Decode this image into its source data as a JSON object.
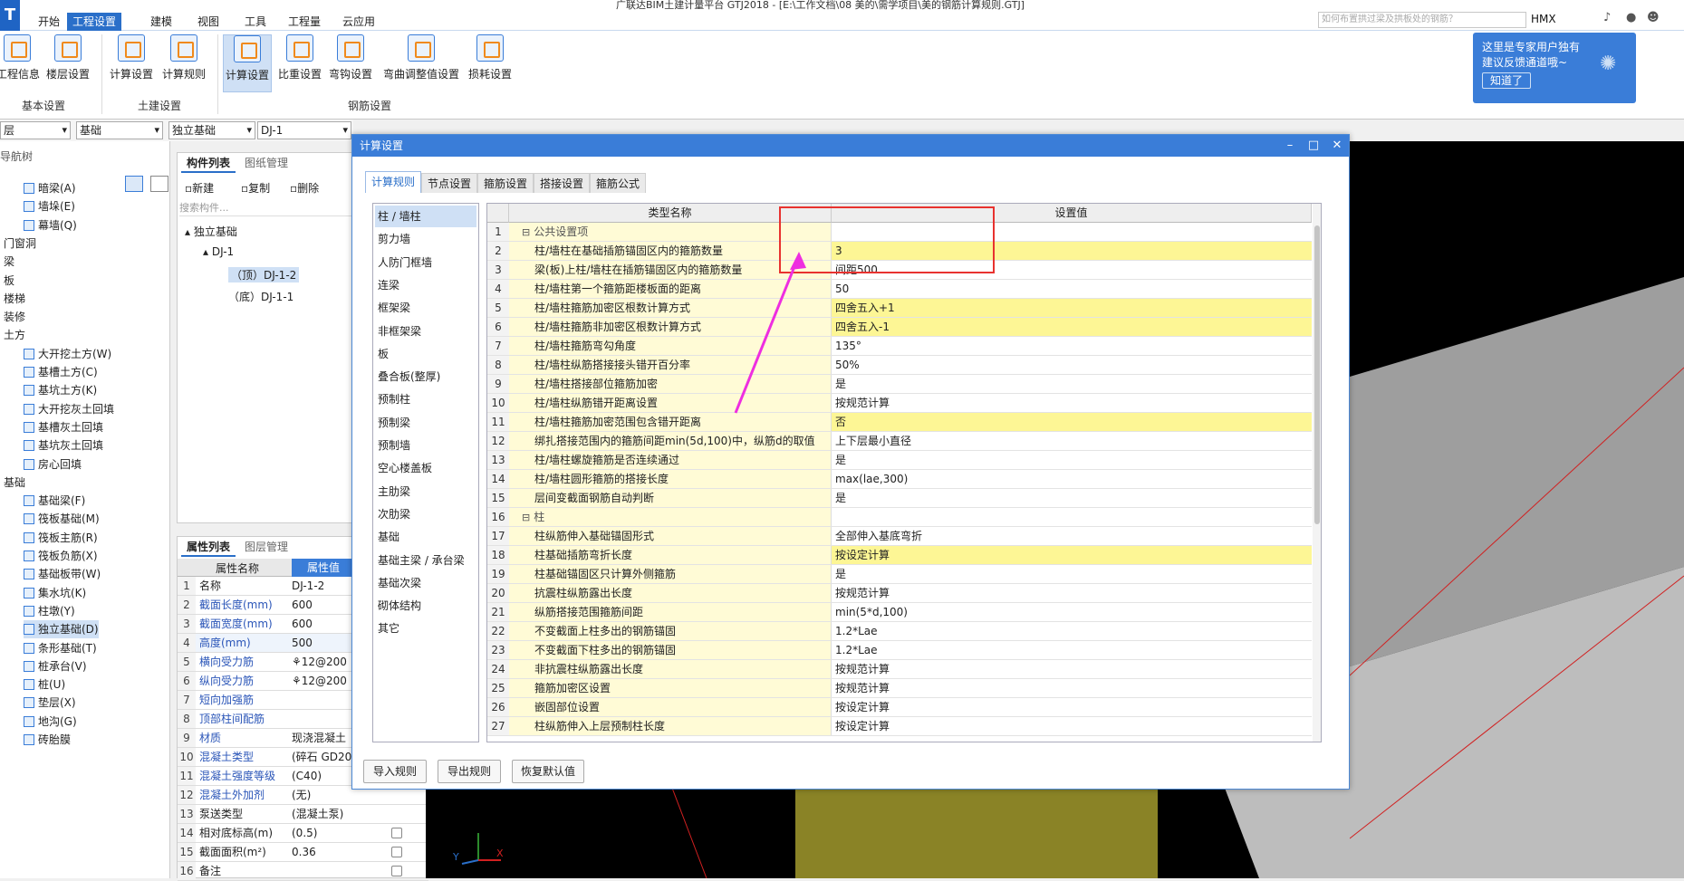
{
  "window": {
    "title": "广联达BIM土建计量平台 GTJ2018 - [E:\\工作文档\\08 美的\\需学项目\\美的钢筋计算规则.GTJ]",
    "search_placeholder": "如何布置拱过梁及拱板处的钢筋？",
    "user": "HMX"
  },
  "ribbon_tabs": [
    "开始",
    "工程设置",
    "建模",
    "视图",
    "工具",
    "工程量",
    "云应用"
  ],
  "ribbon_buttons": [
    "工程信息",
    "楼层设置",
    "计算设置",
    "计算规则",
    "计算设置",
    "比重设置",
    "弯钩设置",
    "弯曲调整值设置",
    "损耗设置"
  ],
  "ribbon_groups": [
    "基本设置",
    "土建设置",
    "钢筋设置"
  ],
  "combos": [
    "层",
    "基础",
    "独立基础",
    "DJ-1"
  ],
  "nav": {
    "title": "导航树",
    "items": [
      {
        "label": "暗梁(A)",
        "type": "item"
      },
      {
        "label": "墙垛(E)",
        "type": "item"
      },
      {
        "label": "幕墙(Q)",
        "type": "item"
      },
      {
        "label": "门窗洞",
        "type": "cat"
      },
      {
        "label": "梁",
        "type": "cat"
      },
      {
        "label": "板",
        "type": "cat"
      },
      {
        "label": "楼梯",
        "type": "cat"
      },
      {
        "label": "装修",
        "type": "cat"
      },
      {
        "label": "土方",
        "type": "cat"
      },
      {
        "label": "大开挖土方(W)",
        "type": "item"
      },
      {
        "label": "基槽土方(C)",
        "type": "item"
      },
      {
        "label": "基坑土方(K)",
        "type": "item"
      },
      {
        "label": "大开挖灰土回填",
        "type": "item"
      },
      {
        "label": "基槽灰土回填",
        "type": "item"
      },
      {
        "label": "基坑灰土回填",
        "type": "item"
      },
      {
        "label": "房心回填",
        "type": "item"
      },
      {
        "label": "基础",
        "type": "cat"
      },
      {
        "label": "基础梁(F)",
        "type": "item"
      },
      {
        "label": "筏板基础(M)",
        "type": "item"
      },
      {
        "label": "筏板主筋(R)",
        "type": "item"
      },
      {
        "label": "筏板负筋(X)",
        "type": "item"
      },
      {
        "label": "基础板带(W)",
        "type": "item"
      },
      {
        "label": "集水坑(K)",
        "type": "item"
      },
      {
        "label": "柱墩(Y)",
        "type": "item"
      },
      {
        "label": "独立基础(D)",
        "type": "sel"
      },
      {
        "label": "条形基础(T)",
        "type": "item"
      },
      {
        "label": "桩承台(V)",
        "type": "item"
      },
      {
        "label": "桩(U)",
        "type": "item"
      },
      {
        "label": "垫层(X)",
        "type": "item"
      },
      {
        "label": "地沟(G)",
        "type": "item"
      },
      {
        "label": "砖胎膜",
        "type": "item"
      }
    ]
  },
  "complist": {
    "tabs": [
      "构件列表",
      "图纸管理"
    ],
    "toolbar": [
      "新建",
      "复制",
      "删除"
    ],
    "search_placeholder": "搜索构件...",
    "tree": [
      "独立基础",
      "DJ-1",
      "（顶）DJ-1-2",
      "（底）DJ-1-1"
    ]
  },
  "props": {
    "tabs": [
      "属性列表",
      "图层管理"
    ],
    "headers": [
      "属性名称",
      "属性值"
    ],
    "rows": [
      {
        "n": "1",
        "k": "名称",
        "v": "DJ-1-2",
        "c": false
      },
      {
        "n": "2",
        "k": "截面长度(mm)",
        "v": "600",
        "c": false
      },
      {
        "n": "3",
        "k": "截面宽度(mm)",
        "v": "600",
        "c": false
      },
      {
        "n": "4",
        "k": "高度(mm)",
        "v": "500",
        "c": false
      },
      {
        "n": "5",
        "k": "横向受力筋",
        "v": "⚘12@200",
        "c": false
      },
      {
        "n": "6",
        "k": "纵向受力筋",
        "v": "⚘12@200",
        "c": false
      },
      {
        "n": "7",
        "k": "短向加强筋",
        "v": "",
        "c": false
      },
      {
        "n": "8",
        "k": "顶部柱间配筋",
        "v": "",
        "c": false
      },
      {
        "n": "9",
        "k": "材质",
        "v": "现浇混凝土",
        "c": false
      },
      {
        "n": "10",
        "k": "混凝土类型",
        "v": "(碎石 GD20",
        "c": false
      },
      {
        "n": "11",
        "k": "混凝土强度等级",
        "v": "(C40)",
        "c": false
      },
      {
        "n": "12",
        "k": "混凝土外加剂",
        "v": "(无)",
        "c": false
      },
      {
        "n": "13",
        "k": "泵送类型",
        "v": "(混凝土泵)",
        "c": false
      },
      {
        "n": "14",
        "k": "相对底标高(m)",
        "v": "(0.5)",
        "c": true
      },
      {
        "n": "15",
        "k": "截面面积(m²)",
        "v": "0.36",
        "c": true
      },
      {
        "n": "16",
        "k": "备注",
        "v": "",
        "c": true
      }
    ]
  },
  "dialog": {
    "title": "计算设置",
    "tabs": [
      "计算规则",
      "节点设置",
      "箍筋设置",
      "搭接设置",
      "箍筋公式"
    ],
    "categories": [
      "柱 / 墙柱",
      "剪力墙",
      "人防门框墙",
      "连梁",
      "框架梁",
      "非框架梁",
      "板",
      "叠合板(整厚)",
      "预制柱",
      "预制梁",
      "预制墙",
      "空心楼盖板",
      "主肋梁",
      "次肋梁",
      "基础",
      "基础主梁 / 承台梁",
      "基础次梁",
      "砌体结构",
      "其它"
    ],
    "headers": [
      "类型名称",
      "设置值"
    ],
    "rows": [
      {
        "n": "1",
        "k": "公共设置项",
        "v": "",
        "g": true,
        "h": false
      },
      {
        "n": "2",
        "k": "柱/墙柱在基础插筋锚固区内的箍筋数量",
        "v": "3",
        "g": false,
        "h": true
      },
      {
        "n": "3",
        "k": "梁(板)上柱/墙柱在插筋锚固区内的箍筋数量",
        "v": "间距500",
        "g": false,
        "h": false
      },
      {
        "n": "4",
        "k": "柱/墙柱第一个箍筋距楼板面的距离",
        "v": "50",
        "g": false,
        "h": false
      },
      {
        "n": "5",
        "k": "柱/墙柱箍筋加密区根数计算方式",
        "v": "四舍五入+1",
        "g": false,
        "h": true
      },
      {
        "n": "6",
        "k": "柱/墙柱箍筋非加密区根数计算方式",
        "v": "四舍五入-1",
        "g": false,
        "h": true
      },
      {
        "n": "7",
        "k": "柱/墙柱箍筋弯勾角度",
        "v": "135°",
        "g": false,
        "h": false
      },
      {
        "n": "8",
        "k": "柱/墙柱纵筋搭接接头错开百分率",
        "v": "50%",
        "g": false,
        "h": false
      },
      {
        "n": "9",
        "k": "柱/墙柱搭接部位箍筋加密",
        "v": "是",
        "g": false,
        "h": false
      },
      {
        "n": "10",
        "k": "柱/墙柱纵筋错开距离设置",
        "v": "按规范计算",
        "g": false,
        "h": false
      },
      {
        "n": "11",
        "k": "柱/墙柱箍筋加密范围包含错开距离",
        "v": "否",
        "g": false,
        "h": true
      },
      {
        "n": "12",
        "k": "绑扎搭接范围内的箍筋间距min(5d,100)中，纵筋d的取值",
        "v": "上下层最小直径",
        "g": false,
        "h": false
      },
      {
        "n": "13",
        "k": "柱/墙柱螺旋箍筋是否连续通过",
        "v": "是",
        "g": false,
        "h": false
      },
      {
        "n": "14",
        "k": "柱/墙柱圆形箍筋的搭接长度",
        "v": "max(lae,300)",
        "g": false,
        "h": false
      },
      {
        "n": "15",
        "k": "层间变截面钢筋自动判断",
        "v": "是",
        "g": false,
        "h": false
      },
      {
        "n": "16",
        "k": "柱",
        "v": "",
        "g": true,
        "h": false
      },
      {
        "n": "17",
        "k": "柱纵筋伸入基础锚固形式",
        "v": "全部伸入基底弯折",
        "g": false,
        "h": false
      },
      {
        "n": "18",
        "k": "柱基础插筋弯折长度",
        "v": "按设定计算",
        "g": false,
        "h": true
      },
      {
        "n": "19",
        "k": "柱基础锚固区只计算外侧箍筋",
        "v": "是",
        "g": false,
        "h": false
      },
      {
        "n": "20",
        "k": "抗震柱纵筋露出长度",
        "v": "按规范计算",
        "g": false,
        "h": false
      },
      {
        "n": "21",
        "k": "纵筋搭接范围箍筋间距",
        "v": "min(5*d,100)",
        "g": false,
        "h": false
      },
      {
        "n": "22",
        "k": "不变截面上柱多出的钢筋锚固",
        "v": "1.2*Lae",
        "g": false,
        "h": false
      },
      {
        "n": "23",
        "k": "不变截面下柱多出的钢筋锚固",
        "v": "1.2*Lae",
        "g": false,
        "h": false
      },
      {
        "n": "24",
        "k": "非抗震柱纵筋露出长度",
        "v": "按规范计算",
        "g": false,
        "h": false
      },
      {
        "n": "25",
        "k": "箍筋加密区设置",
        "v": "按规范计算",
        "g": false,
        "h": false
      },
      {
        "n": "26",
        "k": "嵌固部位设置",
        "v": "按设定计算",
        "g": false,
        "h": false
      },
      {
        "n": "27",
        "k": "柱纵筋伸入上层预制柱长度",
        "v": "按设定计算",
        "g": false,
        "h": false
      }
    ],
    "buttons": [
      "导入规则",
      "导出规则",
      "恢复默认值"
    ]
  },
  "tip": {
    "text": "这里是专家用户独有建议反馈通道哦~",
    "button": "知道了"
  },
  "colors": {
    "accent": "#3a7dd8",
    "highlight": "#fdf695",
    "name_bg": "#fffbd6",
    "annotation": "#e8322f",
    "arrow": "#ee2ee0"
  }
}
